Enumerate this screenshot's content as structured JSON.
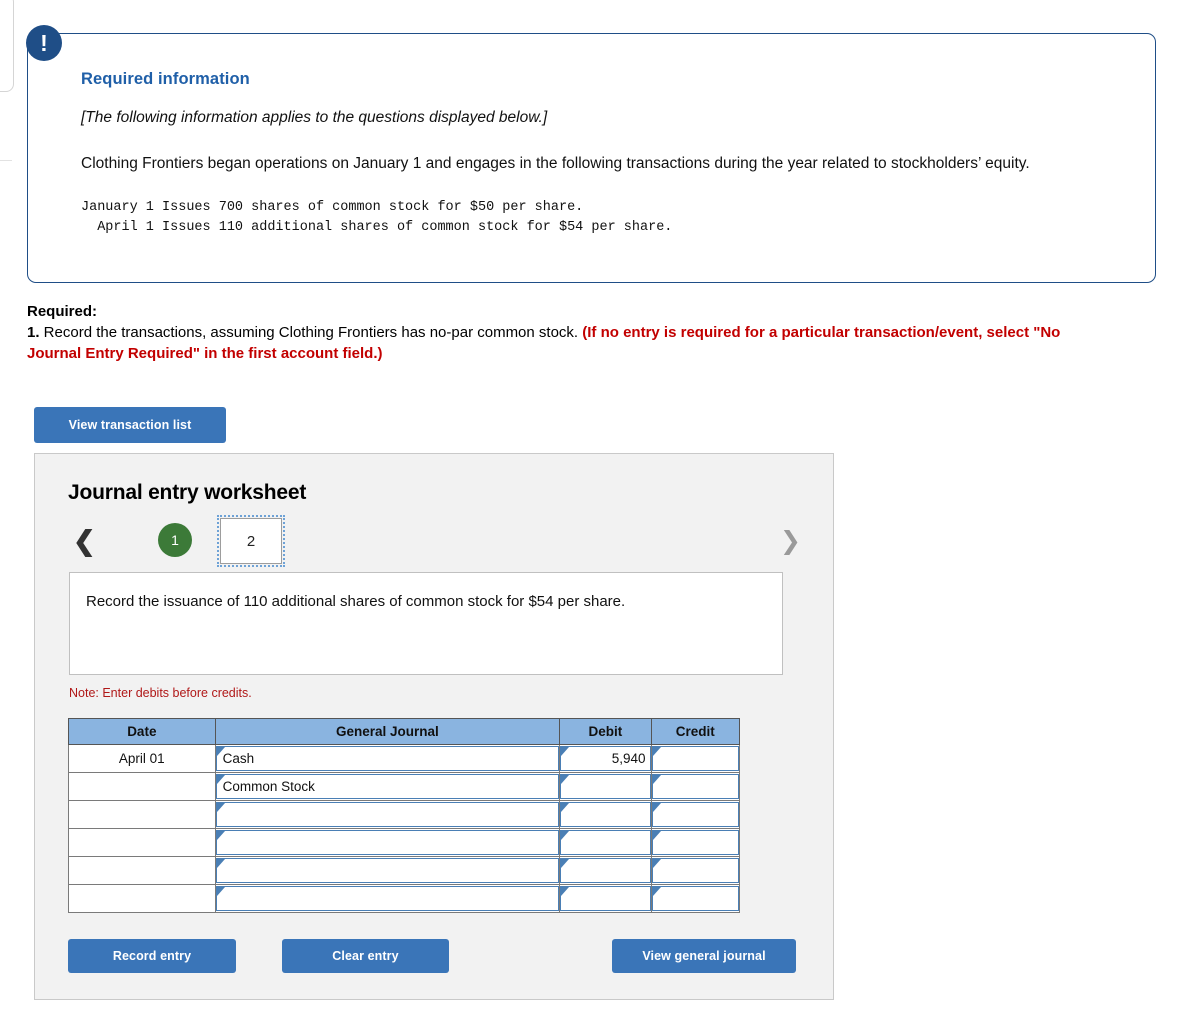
{
  "callout": {
    "icon": "exclamation-icon",
    "title": "Required information",
    "italic_note": "[The following information applies to the questions displayed below.]",
    "body": "Clothing Frontiers began operations on January 1 and engages in the following transactions during the year related to stockholders’ equity.",
    "transactions_mono": "January 1 Issues 700 shares of common stock for $50 per share.\n  April 1 Issues 110 additional shares of common stock for $54 per share."
  },
  "required": {
    "label": "Required:",
    "number": "1.",
    "text": " Record the transactions, assuming Clothing Frontiers has no-par common stock. ",
    "red_text": "(If no entry is required for a particular transaction/event, select \"No Journal Entry Required\" in the first account field.)"
  },
  "buttons": {
    "view_transaction_list": "View transaction list",
    "record_entry": "Record entry",
    "clear_entry": "Clear entry",
    "view_general_journal": "View general journal"
  },
  "worksheet": {
    "title": "Journal entry worksheet",
    "prev_icon": "chevron-left-icon",
    "next_icon": "chevron-right-icon",
    "pages": [
      {
        "label": "1",
        "state": "completed"
      },
      {
        "label": "2",
        "state": "selected"
      }
    ],
    "instruction": "Record the issuance of 110 additional shares of common stock for $54 per share.",
    "note": "Note: Enter debits before credits."
  },
  "journal_table": {
    "headers": [
      "Date",
      "General Journal",
      "Debit",
      "Credit"
    ],
    "rows": [
      {
        "date": "April 01",
        "account": "Cash",
        "debit": "5,940",
        "credit": ""
      },
      {
        "date": "",
        "account": "Common Stock",
        "debit": "",
        "credit": ""
      },
      {
        "date": "",
        "account": "",
        "debit": "",
        "credit": ""
      },
      {
        "date": "",
        "account": "",
        "debit": "",
        "credit": ""
      },
      {
        "date": "",
        "account": "",
        "debit": "",
        "credit": ""
      },
      {
        "date": "",
        "account": "",
        "debit": "",
        "credit": ""
      }
    ]
  },
  "colors": {
    "accent_blue": "#3a75b8",
    "callout_border": "#1f4e87",
    "title_blue": "#1f5fa8",
    "alert_red": "#c20000",
    "note_red": "#b01818",
    "table_header_blue": "#8ab4e0",
    "page_green": "#3c7a38"
  }
}
